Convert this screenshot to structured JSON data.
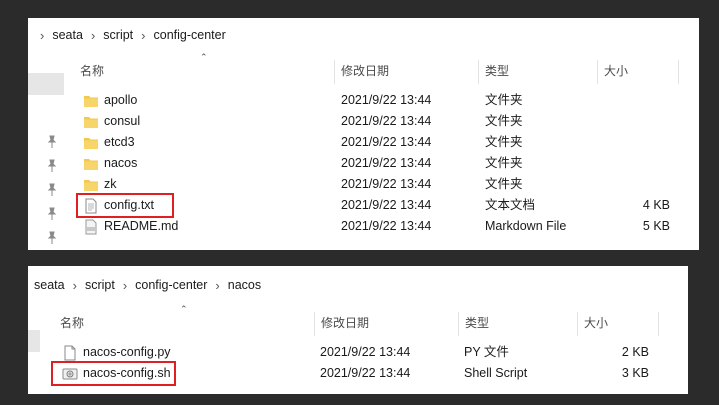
{
  "window1": {
    "breadcrumb": [
      "seata",
      "script",
      "config-center"
    ],
    "columns": {
      "name": "名称",
      "modified": "修改日期",
      "type": "类型",
      "size": "大小"
    },
    "rows": [
      {
        "name": "apollo",
        "modified": "2021/9/22 13:44",
        "type": "文件夹",
        "size": "",
        "icon": "folder-icon"
      },
      {
        "name": "consul",
        "modified": "2021/9/22 13:44",
        "type": "文件夹",
        "size": "",
        "icon": "folder-icon"
      },
      {
        "name": "etcd3",
        "modified": "2021/9/22 13:44",
        "type": "文件夹",
        "size": "",
        "icon": "folder-icon"
      },
      {
        "name": "nacos",
        "modified": "2021/9/22 13:44",
        "type": "文件夹",
        "size": "",
        "icon": "folder-icon"
      },
      {
        "name": "zk",
        "modified": "2021/9/22 13:44",
        "type": "文件夹",
        "size": "",
        "icon": "folder-icon"
      },
      {
        "name": "config.txt",
        "modified": "2021/9/22 13:44",
        "type": "文本文档",
        "size": "4 KB",
        "icon": "text-file-icon"
      },
      {
        "name": "README.md",
        "modified": "2021/9/22 13:44",
        "type": "Markdown File",
        "size": "5 KB",
        "icon": "markdown-file-icon"
      }
    ]
  },
  "window2": {
    "breadcrumb": [
      "seata",
      "script",
      "config-center",
      "nacos"
    ],
    "columns": {
      "name": "名称",
      "modified": "修改日期",
      "type": "类型",
      "size": "大小"
    },
    "rows": [
      {
        "name": "nacos-config.py",
        "modified": "2021/9/22 13:44",
        "type": "PY 文件",
        "size": "2 KB",
        "icon": "python-file-icon"
      },
      {
        "name": "nacos-config.sh",
        "modified": "2021/9/22 13:44",
        "type": "Shell Script",
        "size": "3 KB",
        "icon": "shell-script-icon"
      }
    ]
  },
  "colors": {
    "highlight": "#e02020",
    "folder": "#f3c94c",
    "divider": "#e3e3e3"
  }
}
